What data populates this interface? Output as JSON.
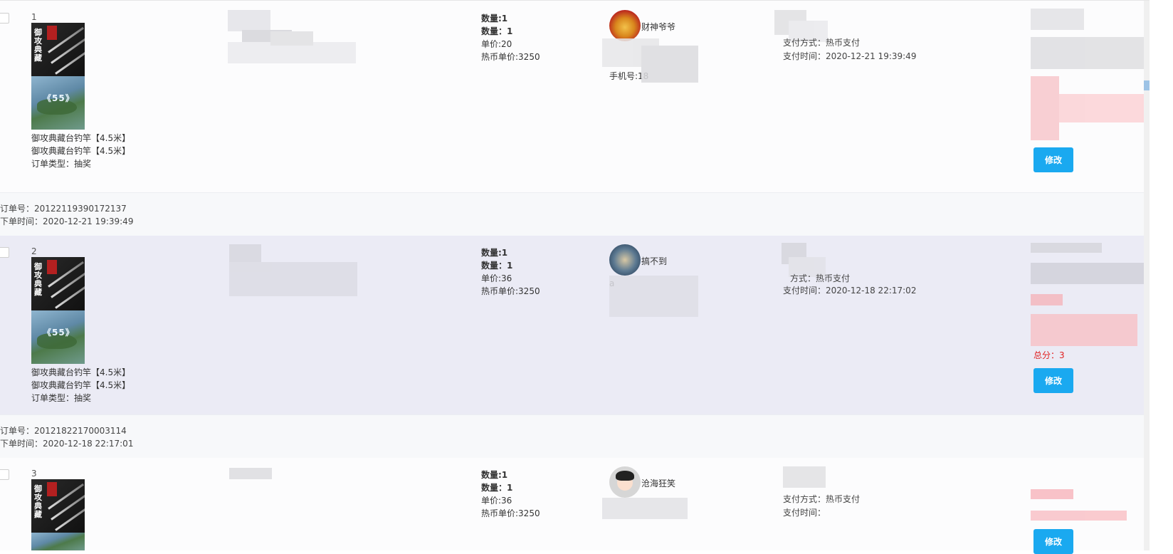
{
  "rows": [
    {
      "index": "1",
      "product_name_1": "御攻典藏台钓竿【4.5米】",
      "product_name_2": "御攻典藏台钓竿【4.5米】",
      "order_type": "订单类型：抽奖",
      "qty_a": "数量:1",
      "qty_b": "数量：1",
      "unit_price": "单价:20",
      "hot_coin_price": "热币单价:3250",
      "username": "财神爷爷",
      "phone_fragment": "手机号:18",
      "pay_method_fragment": "支付方式：热币支付",
      "pay_time": "支付时间：2020-12-21 19:39:49",
      "edit_label": "修改"
    },
    {
      "index": "2",
      "product_name_1": "御攻典藏台钓竿【4.5米】",
      "product_name_2": "御攻典藏台钓竿【4.5米】",
      "order_type": "订单类型：抽奖",
      "qty_a": "数量:1",
      "qty_b": "数量：1",
      "unit_price": "单价:36",
      "hot_coin_price": "热币单价:3250",
      "username": "搞不到",
      "phone_fragment": "a",
      "pay_method_fragment": "方式：热币支付",
      "pay_time": "支付时间：2020-12-18 22:17:02",
      "red_note": "总分：3",
      "edit_label": "修改"
    },
    {
      "index": "3",
      "qty_a": "数量:1",
      "qty_b": "数量：1",
      "unit_price": "单价:36",
      "hot_coin_price": "热币单价:3250",
      "username": "沧海狂笑",
      "pay_method": "支付方式：热币支付",
      "pay_time": "支付时间：",
      "edit_label": "修改"
    }
  ],
  "order_infos": [
    {
      "order_no": "订单号：20122119390172137",
      "order_time": "下单时间：2020-12-21 19:39:49"
    },
    {
      "order_no": "订单号：20121822170003114",
      "order_time": "下单时间：2020-12-18 22:17:01"
    }
  ],
  "thumbnails": {
    "pole_label": "御攻典藏",
    "map_label": "《55》"
  },
  "colors": {
    "edit_button": "#1aa9f0",
    "hover_row": "#ebebf5",
    "warning_text": "#e02020"
  }
}
